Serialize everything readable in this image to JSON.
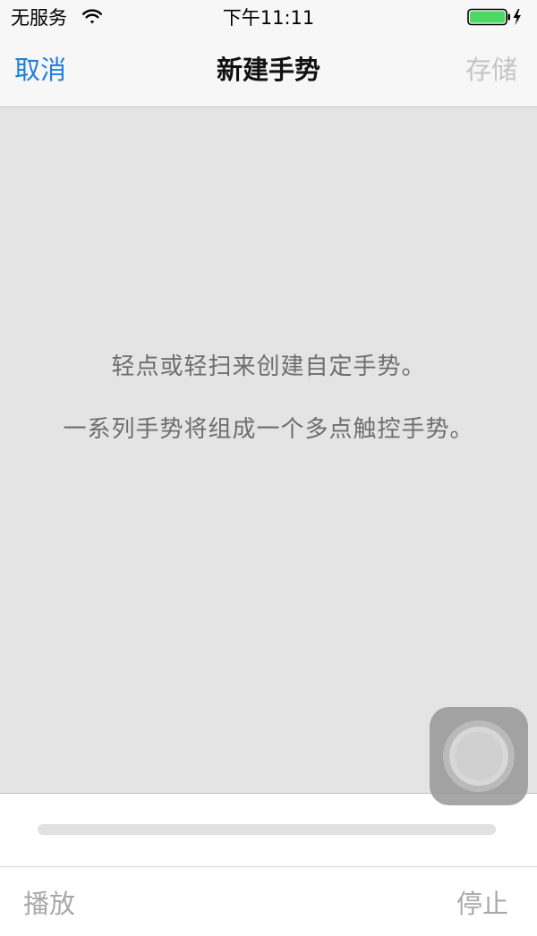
{
  "status_bar": {
    "carrier": "无服务",
    "time": "下午11:11",
    "wifi_icon": "wifi-icon",
    "battery_icon": "battery-charging-icon",
    "battery_color": "#4cd964"
  },
  "nav_bar": {
    "cancel_label": "取消",
    "title": "新建手势",
    "save_label": "存储",
    "cancel_color": "#1d7fe0",
    "save_enabled": false
  },
  "gesture_area": {
    "hint_line_1": "轻点或轻扫来创建自定手势。",
    "hint_line_2": "一系列手势将组成一个多点触控手势。"
  },
  "assistive_touch": {
    "icon": "assistive-touch-icon"
  },
  "playback": {
    "progress": 0
  },
  "toolbar": {
    "play_label": "播放",
    "stop_label": "停止"
  }
}
